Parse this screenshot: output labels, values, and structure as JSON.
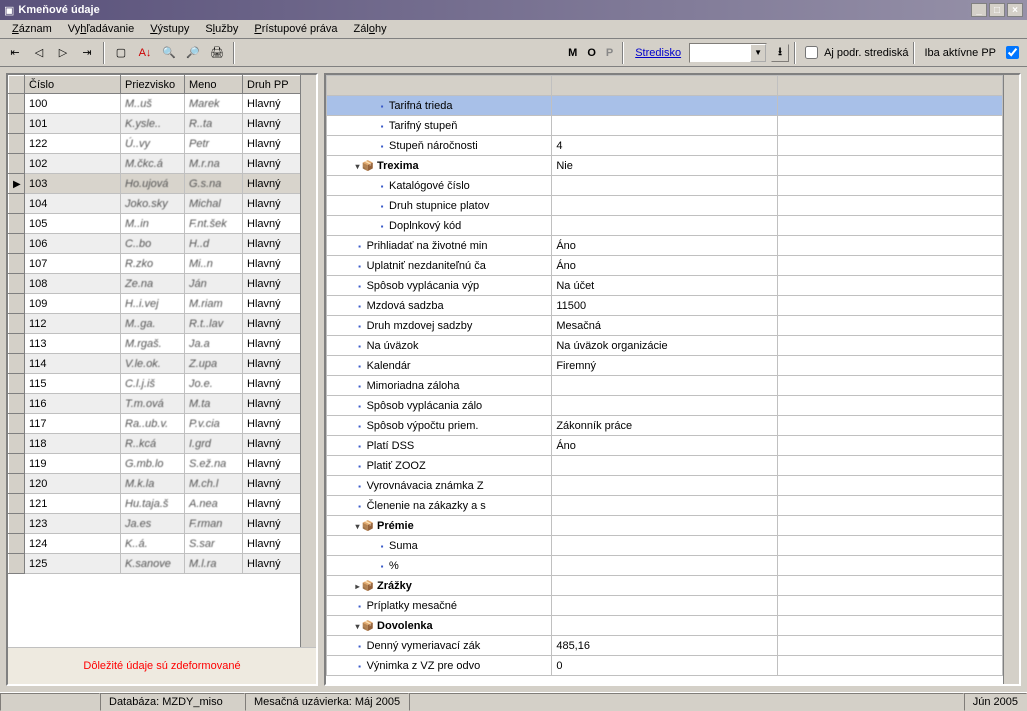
{
  "window": {
    "title": "Kmeňové údaje"
  },
  "menu": [
    "Záznam",
    "Vyhľadávanie",
    "Výstupy",
    "Služby",
    "Prístupové práva",
    "Zálohy"
  ],
  "toolbar": {
    "m": "M",
    "o": "O",
    "p": "P",
    "stredisko_link": "Stredisko",
    "aj_podr": "Aj podr. strediská",
    "iba_aktivne": "Iba aktívne PP"
  },
  "left": {
    "headers": [
      "Číslo",
      "Priezvisko",
      "Meno",
      "Druh PP"
    ],
    "selected": 4,
    "rows": [
      {
        "n": "100",
        "p": "M..uš",
        "m": "Marek",
        "d": "Hlavný"
      },
      {
        "n": "101",
        "p": "K.ysle..",
        "m": "R..ta",
        "d": "Hlavný"
      },
      {
        "n": "122",
        "p": "Ú..vy",
        "m": "Petr",
        "d": "Hlavný"
      },
      {
        "n": "102",
        "p": "M.čkc.á",
        "m": "M.r.na",
        "d": "Hlavný"
      },
      {
        "n": "103",
        "p": "Ho.ujová",
        "m": "G.s.na",
        "d": "Hlavný"
      },
      {
        "n": "104",
        "p": "Joko.sky",
        "m": "Michal",
        "d": "Hlavný"
      },
      {
        "n": "105",
        "p": "M..in",
        "m": "F.nt.šek",
        "d": "Hlavný"
      },
      {
        "n": "106",
        "p": "C..bo",
        "m": "H..d",
        "d": "Hlavný"
      },
      {
        "n": "107",
        "p": "R.zko",
        "m": "Mi..n",
        "d": "Hlavný"
      },
      {
        "n": "108",
        "p": "Ze.na",
        "m": "Ján",
        "d": "Hlavný"
      },
      {
        "n": "109",
        "p": "H..i.vej",
        "m": "M.riam",
        "d": "Hlavný"
      },
      {
        "n": "112",
        "p": "M..ga.",
        "m": "R.t..lav",
        "d": "Hlavný"
      },
      {
        "n": "113",
        "p": "M.rgaš.",
        "m": "Ja.a",
        "d": "Hlavný"
      },
      {
        "n": "114",
        "p": "V.le.ok.",
        "m": "Z.upa",
        "d": "Hlavný"
      },
      {
        "n": "115",
        "p": "C.l.j.iš",
        "m": "Jo.e.",
        "d": "Hlavný"
      },
      {
        "n": "116",
        "p": "T.m.ová",
        "m": "M.ta",
        "d": "Hlavný"
      },
      {
        "n": "117",
        "p": "Ra..ub.v.",
        "m": "P.v.cia",
        "d": "Hlavný"
      },
      {
        "n": "118",
        "p": "R..kcá",
        "m": "I.grd",
        "d": "Hlavný"
      },
      {
        "n": "119",
        "p": "G.mb.lo",
        "m": "S.ež.na",
        "d": "Hlavný"
      },
      {
        "n": "120",
        "p": "M.k.la",
        "m": "M.ch.l",
        "d": "Hlavný"
      },
      {
        "n": "121",
        "p": "Hu.taja.š",
        "m": "A.nea",
        "d": "Hlavný"
      },
      {
        "n": "123",
        "p": "Ja.es",
        "m": "F.rman",
        "d": "Hlavný"
      },
      {
        "n": "124",
        "p": "K..á.",
        "m": "S.sar",
        "d": "Hlavný"
      },
      {
        "n": "125",
        "p": "K.sanove",
        "m": "M.l.ra",
        "d": "Hlavný"
      }
    ],
    "footer": "Dôležité údaje sú zdeformované"
  },
  "right": {
    "selected": 0,
    "rows": [
      {
        "level": 1,
        "icon": "bullet",
        "label": "Tarifná trieda",
        "val": ""
      },
      {
        "level": 1,
        "icon": "bullet",
        "label": "Tarifný stupeň",
        "val": ""
      },
      {
        "level": 1,
        "icon": "bullet",
        "label": "Stupeň náročnosti",
        "val": "4"
      },
      {
        "level": 0,
        "icon": "box",
        "label": "Trexima",
        "val": "Nie",
        "bold": true,
        "exp": true
      },
      {
        "level": 1,
        "icon": "bullet",
        "label": "Katalógové číslo",
        "val": ""
      },
      {
        "level": 1,
        "icon": "bullet",
        "label": "Druh stupnice platov",
        "val": ""
      },
      {
        "level": 1,
        "icon": "bullet",
        "label": "Doplnkový kód",
        "val": ""
      },
      {
        "level": 0,
        "icon": "bullet",
        "label": "Prihliadať na životné min",
        "val": "Áno"
      },
      {
        "level": 0,
        "icon": "bullet",
        "label": "Uplatniť nezdaniteľnú ča",
        "val": "Áno"
      },
      {
        "level": 0,
        "icon": "bullet",
        "label": "Spôsob vyplácania výp",
        "val": "Na účet"
      },
      {
        "level": 0,
        "icon": "bullet",
        "label": "Mzdová sadzba",
        "val": "11500"
      },
      {
        "level": 0,
        "icon": "bullet",
        "label": "Druh mzdovej sadzby",
        "val": "Mesačná"
      },
      {
        "level": 0,
        "icon": "bullet",
        "label": "Na úväzok",
        "val": "Na úväzok organizácie"
      },
      {
        "level": 0,
        "icon": "bullet",
        "label": "Kalendár",
        "val": "Firemný"
      },
      {
        "level": 0,
        "icon": "bullet",
        "label": "Mimoriadna záloha",
        "val": ""
      },
      {
        "level": 0,
        "icon": "bullet",
        "label": "Spôsob vyplácania zálo",
        "val": ""
      },
      {
        "level": 0,
        "icon": "bullet",
        "label": "Spôsob výpočtu priem.",
        "val": "Zákonník práce"
      },
      {
        "level": 0,
        "icon": "bullet",
        "label": "Platí DSS",
        "val": "Áno"
      },
      {
        "level": 0,
        "icon": "bullet",
        "label": "Platiť ZOOZ",
        "val": ""
      },
      {
        "level": 0,
        "icon": "bullet",
        "label": "Vyrovnávacia známka Z",
        "val": ""
      },
      {
        "level": 0,
        "icon": "bullet",
        "label": "Členenie na zákazky a s",
        "val": ""
      },
      {
        "level": 0,
        "icon": "box",
        "label": "Prémie",
        "val": "",
        "bold": true,
        "exp": true
      },
      {
        "level": 1,
        "icon": "bullet",
        "label": "Suma",
        "val": ""
      },
      {
        "level": 1,
        "icon": "bullet",
        "label": "%",
        "val": ""
      },
      {
        "level": 0,
        "icon": "box",
        "label": "Zrážky",
        "val": "",
        "bold": true,
        "exp": false
      },
      {
        "level": 0,
        "icon": "bullet",
        "label": "Príplatky mesačné",
        "val": ""
      },
      {
        "level": 0,
        "icon": "box",
        "label": "Dovolenka",
        "val": "",
        "bold": true,
        "exp": true
      },
      {
        "level": 0,
        "icon": "bullet",
        "label": "Denný vymeriavací zák",
        "val": "485,16"
      },
      {
        "level": 0,
        "icon": "bullet",
        "label": "Výnimka z VZ pre odvo",
        "val": "0"
      }
    ]
  },
  "status": {
    "db": "Databáza: MZDY_miso",
    "mesacna": "Mesačná uzávierka: Máj 2005",
    "right": "Jún 2005"
  }
}
